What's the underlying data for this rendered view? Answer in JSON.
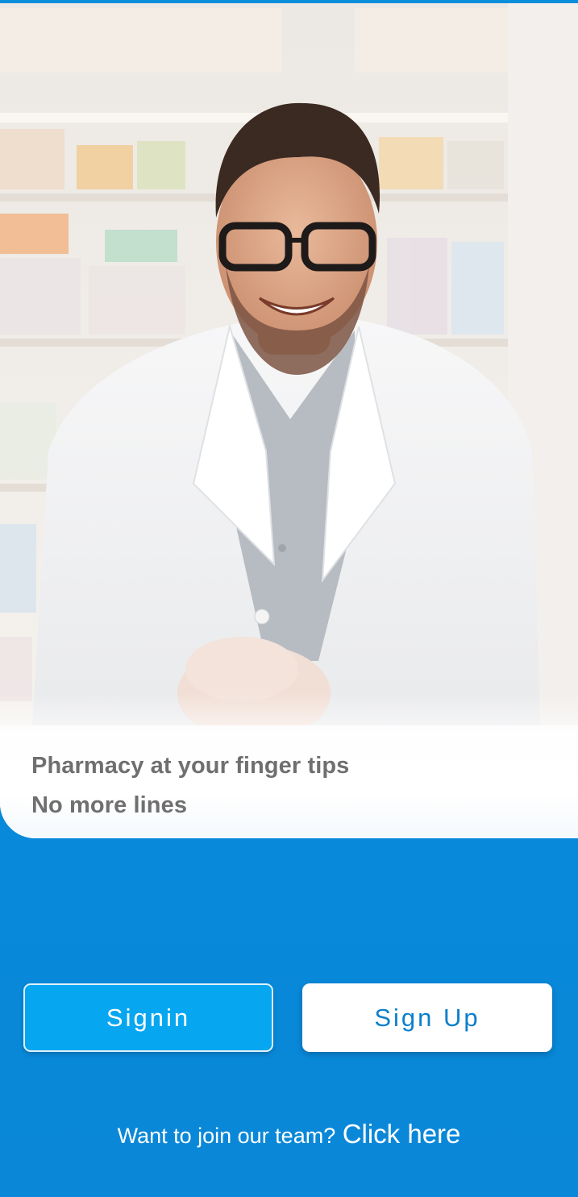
{
  "hero": {
    "tagline_line1": "Pharmacy at your finger tips",
    "tagline_line2": "No more lines"
  },
  "actions": {
    "signin_label": "Signin",
    "signup_label": "Sign Up"
  },
  "footer": {
    "join_text": "Want to join our team?",
    "join_link": "Click here"
  },
  "colors": {
    "background": "#0a8fdc",
    "signin_button": "#06a6f0",
    "signup_text": "#0a7fcb",
    "tagline_text": "#6f6f6f"
  }
}
